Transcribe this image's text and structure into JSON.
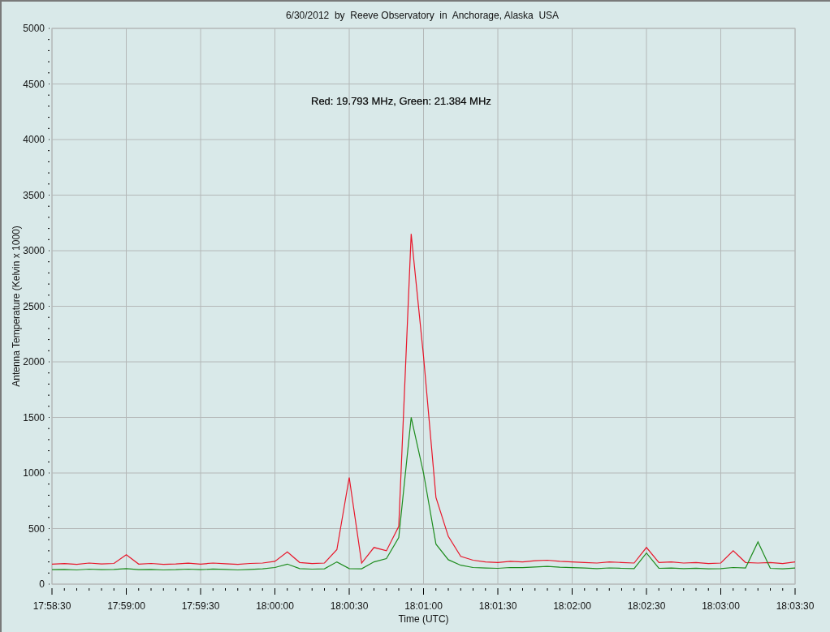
{
  "chart_data": {
    "type": "line",
    "title": "6/30/2012  by  Reeve Observatory  in  Anchorage, Alaska  USA",
    "xlabel": "Time (UTC)",
    "ylabel": "Antenna Temperature (Kelvin x 1000)",
    "categories": [
      "17:58:30",
      null,
      null,
      null,
      null,
      null,
      "17:59:00",
      null,
      null,
      null,
      null,
      null,
      "17:59:30",
      null,
      null,
      null,
      null,
      null,
      "18:00:00",
      null,
      null,
      null,
      null,
      null,
      "18:00:30",
      null,
      null,
      null,
      null,
      null,
      "18:01:00",
      null,
      null,
      null,
      null,
      null,
      "18:01:30",
      null,
      null,
      null,
      null,
      null,
      "18:02:00",
      null,
      null,
      null,
      null,
      null,
      "18:02:30",
      null,
      null,
      null,
      null,
      null,
      "18:03:00",
      null,
      null,
      null,
      null,
      null,
      "18:03:30"
    ],
    "series": [
      {
        "color": "#e8162a",
        "values": [
          180,
          185,
          178,
          190,
          182,
          186,
          265,
          180,
          186,
          178,
          182,
          188,
          180,
          190,
          184,
          178,
          186,
          190,
          205,
          290,
          195,
          185,
          190,
          310,
          960,
          190,
          330,
          300,
          520,
          3150,
          2050,
          780,
          430,
          250,
          215,
          200,
          195,
          205,
          200,
          210,
          215,
          205,
          200,
          195,
          190,
          200,
          195,
          190,
          330,
          195,
          200,
          190,
          195,
          185,
          190,
          300,
          195,
          190,
          195,
          185,
          200
        ]
      },
      {
        "color": "#1e8c1e",
        "values": [
          130,
          132,
          128,
          135,
          130,
          132,
          140,
          130,
          133,
          128,
          130,
          135,
          130,
          136,
          132,
          128,
          133,
          138,
          150,
          180,
          140,
          135,
          138,
          200,
          140,
          138,
          200,
          230,
          420,
          1500,
          1000,
          360,
          220,
          170,
          150,
          145,
          142,
          150,
          148,
          155,
          160,
          152,
          148,
          145,
          140,
          146,
          142,
          140,
          280,
          142,
          145,
          140,
          143,
          138,
          140,
          150,
          145,
          380,
          142,
          138,
          145
        ]
      }
    ],
    "ylim": [
      0,
      5000
    ],
    "grid": true,
    "yticks": [
      0,
      500,
      1000,
      1500,
      2000,
      2500,
      3000,
      3500,
      4000,
      4500,
      5000
    ],
    "annotations": [
      "Red: 19.793 MHz, Green: 21.384 MHz"
    ]
  }
}
